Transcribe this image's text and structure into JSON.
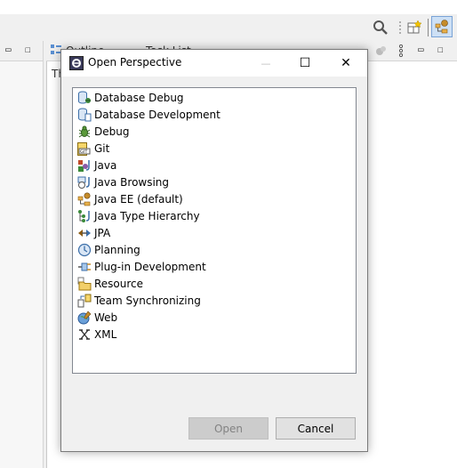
{
  "workbench": {
    "left_pane_controls": [
      "▭",
      "☐"
    ],
    "right_tabs": [
      {
        "label": "Outline"
      },
      {
        "label": "Task List"
      }
    ],
    "right_pane_partial_text": "Th"
  },
  "dialog": {
    "title": "Open Perspective",
    "minimize_glyph": "—",
    "maximize_glyph": "☐",
    "close_glyph": "✕",
    "perspectives": [
      {
        "label": "Database Debug",
        "icon": "database-debug-icon"
      },
      {
        "label": "Database Development",
        "icon": "database-development-icon"
      },
      {
        "label": "Debug",
        "icon": "debug-bug-icon"
      },
      {
        "label": "Git",
        "icon": "git-icon"
      },
      {
        "label": "Java",
        "icon": "java-perspective-icon"
      },
      {
        "label": "Java Browsing",
        "icon": "java-browsing-icon"
      },
      {
        "label": "Java EE (default)",
        "icon": "java-ee-icon"
      },
      {
        "label": "Java Type Hierarchy",
        "icon": "java-type-hierarchy-icon"
      },
      {
        "label": "JPA",
        "icon": "jpa-icon"
      },
      {
        "label": "Planning",
        "icon": "planning-clock-icon"
      },
      {
        "label": "Plug-in Development",
        "icon": "plugin-development-icon"
      },
      {
        "label": "Resource",
        "icon": "resource-folder-icon"
      },
      {
        "label": "Team Synchronizing",
        "icon": "team-synchronizing-icon"
      },
      {
        "label": "Web",
        "icon": "web-globe-icon"
      },
      {
        "label": "XML",
        "icon": "xml-icon"
      }
    ],
    "open_button": "Open",
    "cancel_button": "Cancel"
  }
}
